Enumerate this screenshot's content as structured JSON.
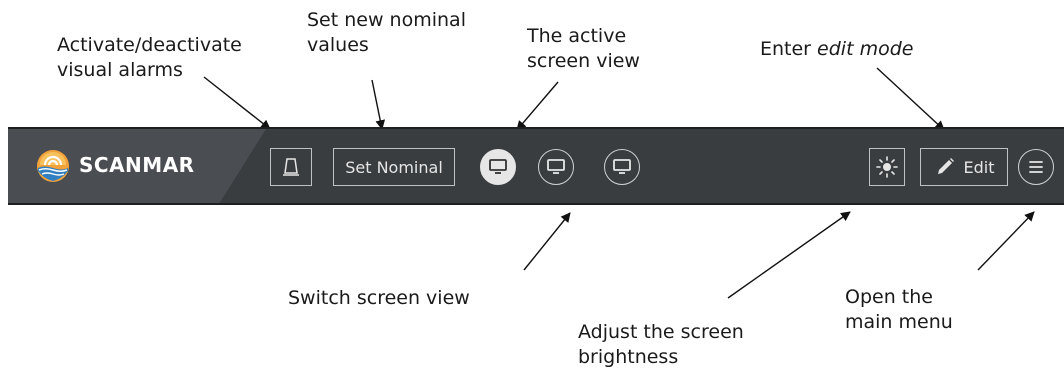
{
  "callouts": {
    "alarms": [
      "Activate/deactivate",
      "visual alarms"
    ],
    "nominal": [
      "Set new nominal",
      "values"
    ],
    "active_view": [
      "The active",
      "screen view"
    ],
    "edit_prefix": "Enter ",
    "edit_italic": "edit mode",
    "switch_view": "Switch screen view",
    "brightness": [
      "Adjust the screen",
      "brightness"
    ],
    "menu": [
      "Open the",
      "main menu"
    ]
  },
  "toolbar": {
    "brand": "SCANMAR",
    "set_nominal_label": "Set Nominal",
    "edit_label": "Edit",
    "alarm_icon": "alarm-beacon-icon",
    "view_icon": "monitor-icon",
    "brightness_icon": "sun-icon",
    "edit_icon": "pencil-icon",
    "menu_icon": "hamburger-menu-icon",
    "screen_views": [
      {
        "icon": "monitor-icon",
        "active": true
      },
      {
        "icon": "monitor-icon",
        "active": false
      },
      {
        "icon": "monitor-icon",
        "active": false
      }
    ]
  },
  "colors": {
    "toolbar_bg": "#3a3d40",
    "brand_bg": "#4a4d51",
    "active_view_bg": "#e6e6e6",
    "logo_orange": "#f2a23a",
    "logo_blue": "#2f7fc1"
  }
}
